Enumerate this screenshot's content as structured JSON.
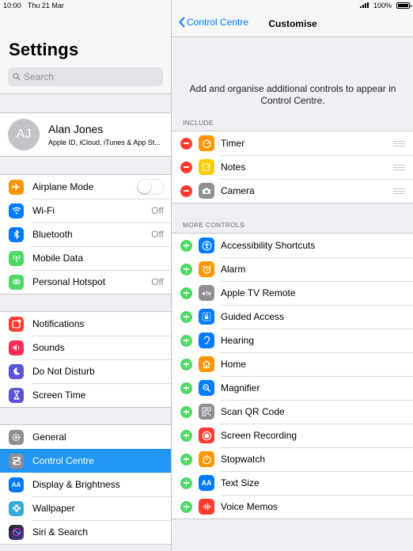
{
  "status": {
    "time": "10:00",
    "date": "Thu 21 Mar",
    "battery": "100%"
  },
  "settings": {
    "title": "Settings",
    "search_placeholder": "Search",
    "profile": {
      "initials": "AJ",
      "name": "Alan Jones",
      "subtitle": "Apple ID, iCloud, iTunes & App St..."
    },
    "group1": [
      {
        "label": "Airplane Mode",
        "icon": "airplane-icon",
        "color": "#ff9500",
        "control": "toggle-off"
      },
      {
        "label": "Wi-Fi",
        "icon": "wifi-icon",
        "color": "#007aff",
        "value": "Off"
      },
      {
        "label": "Bluetooth",
        "icon": "bluetooth-icon",
        "color": "#007aff",
        "value": "Off"
      },
      {
        "label": "Mobile Data",
        "icon": "antenna-icon",
        "color": "#4cd964"
      },
      {
        "label": "Personal Hotspot",
        "icon": "hotspot-icon",
        "color": "#4cd964",
        "value": "Off"
      }
    ],
    "group2": [
      {
        "label": "Notifications",
        "icon": "notifications-icon",
        "color": "#ff3b30"
      },
      {
        "label": "Sounds",
        "icon": "speaker-icon",
        "color": "#ff2d55"
      },
      {
        "label": "Do Not Disturb",
        "icon": "moon-icon",
        "color": "#5856d6"
      },
      {
        "label": "Screen Time",
        "icon": "hourglass-icon",
        "color": "#5856d6"
      }
    ],
    "group3": [
      {
        "label": "General",
        "icon": "gear-icon",
        "color": "#8e8e93"
      },
      {
        "label": "Control Centre",
        "icon": "switches-icon",
        "color": "#8e8e93",
        "selected": true
      },
      {
        "label": "Display & Brightness",
        "icon": "text-size-icon",
        "color": "#007aff"
      },
      {
        "label": "Wallpaper",
        "icon": "flower-icon",
        "color": "#34aadc"
      },
      {
        "label": "Siri & Search",
        "icon": "siri-icon",
        "color": "#222222"
      }
    ]
  },
  "customise": {
    "back_label": "Control Centre",
    "title": "Customise",
    "description": "Add and organise additional controls to appear in Control Centre.",
    "include_header": "INCLUDE",
    "include": [
      {
        "label": "Timer",
        "icon": "timer-icon",
        "color": "#ff9500"
      },
      {
        "label": "Notes",
        "icon": "notes-icon",
        "color": "#ffcc00"
      },
      {
        "label": "Camera",
        "icon": "camera-icon",
        "color": "#8e8e93"
      }
    ],
    "more_header": "MORE CONTROLS",
    "more": [
      {
        "label": "Accessibility Shortcuts",
        "icon": "accessibility-icon",
        "color": "#007aff"
      },
      {
        "label": "Alarm",
        "icon": "alarm-icon",
        "color": "#ff9500"
      },
      {
        "label": "Apple TV Remote",
        "icon": "apple-tv-icon",
        "color": "#8e8e93",
        "glyph": "tv"
      },
      {
        "label": "Guided Access",
        "icon": "lock-icon",
        "color": "#007aff"
      },
      {
        "label": "Hearing",
        "icon": "ear-icon",
        "color": "#007aff"
      },
      {
        "label": "Home",
        "icon": "home-icon",
        "color": "#ff9500"
      },
      {
        "label": "Magnifier",
        "icon": "magnifier-icon",
        "color": "#007aff"
      },
      {
        "label": "Scan QR Code",
        "icon": "qr-code-icon",
        "color": "#8e8e93"
      },
      {
        "label": "Screen Recording",
        "icon": "record-icon",
        "color": "#ff3b30"
      },
      {
        "label": "Stopwatch",
        "icon": "stopwatch-icon",
        "color": "#ff9500"
      },
      {
        "label": "Text Size",
        "icon": "text-size-icon",
        "color": "#007aff",
        "glyph": "AA"
      },
      {
        "label": "Voice Memos",
        "icon": "waveform-icon",
        "color": "#ff3b30"
      }
    ]
  }
}
